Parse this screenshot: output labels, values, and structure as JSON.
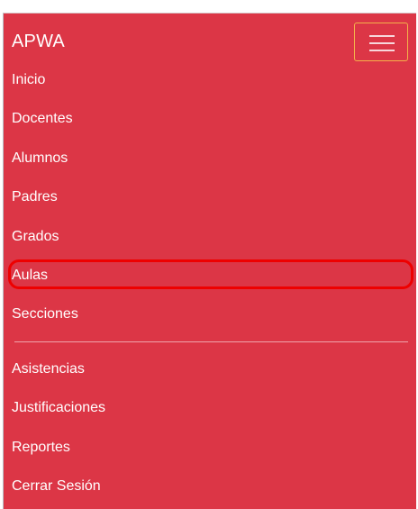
{
  "navbar": {
    "brand": "APWA",
    "toggle_icon": "hamburger-menu-icon",
    "background_color": "#dc3646",
    "highlight_color": "#ee0000"
  },
  "menu": {
    "items": [
      {
        "label": "Inicio"
      },
      {
        "label": "Docentes"
      },
      {
        "label": "Alumnos"
      },
      {
        "label": "Padres"
      },
      {
        "label": "Grados"
      },
      {
        "label": "Aulas"
      },
      {
        "label": "Secciones"
      }
    ],
    "secondary_items": [
      {
        "label": "Asistencias"
      },
      {
        "label": "Justificaciones"
      },
      {
        "label": "Reportes"
      },
      {
        "label": "Cerrar Sesión"
      }
    ]
  }
}
